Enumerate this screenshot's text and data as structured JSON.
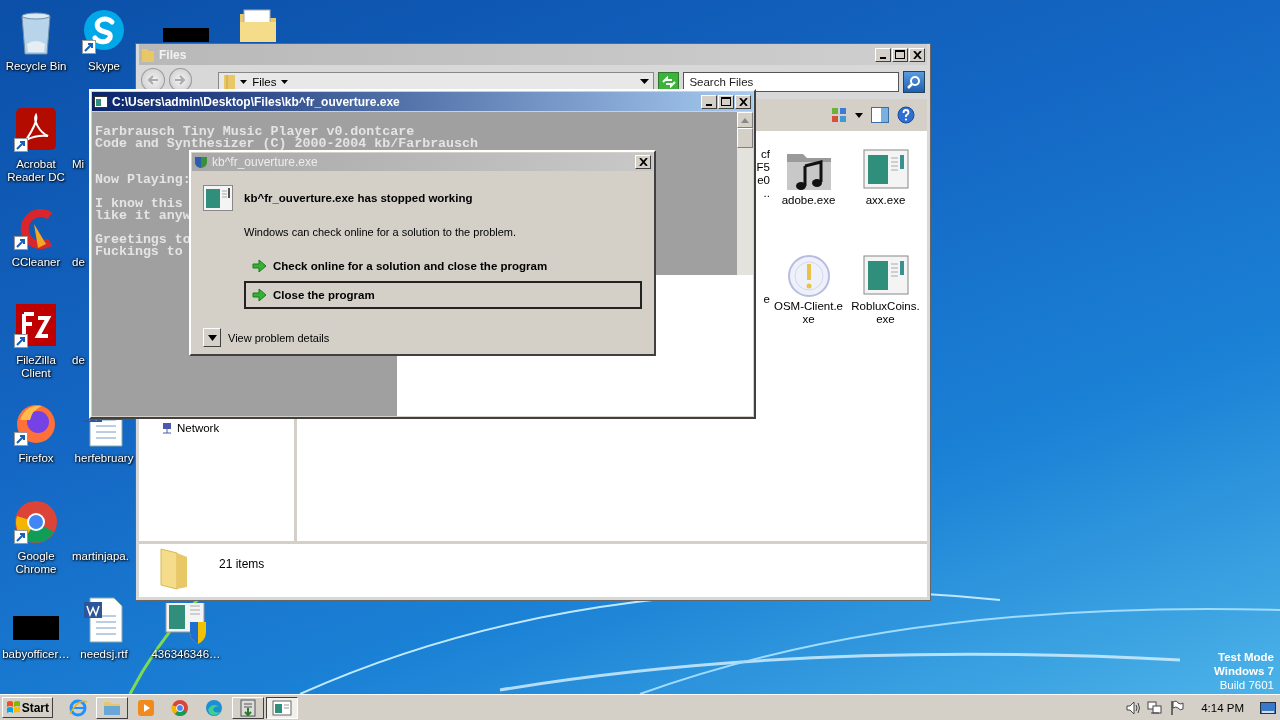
{
  "desktop_icons": [
    {
      "label": "Recycle Bin",
      "kind": "recycle"
    },
    {
      "label": "Acrobat Reader DC",
      "kind": "acrobat",
      "shortcut": true
    },
    {
      "label": "CCleaner",
      "kind": "ccleaner",
      "shortcut": true
    },
    {
      "label": "FileZilla Client",
      "kind": "filezilla",
      "shortcut": true
    },
    {
      "label": "Firefox",
      "kind": "firefox",
      "shortcut": true
    },
    {
      "label": "Google Chrome",
      "kind": "chrome",
      "shortcut": true
    },
    {
      "label": "babyofficer…",
      "kind": "redacted"
    },
    {
      "label": "Skype",
      "kind": "skype",
      "shortcut": true
    },
    {
      "label": "Mi",
      "kind": "covered"
    },
    {
      "label": "de",
      "kind": "covered"
    },
    {
      "label": "de",
      "kind": "covered"
    },
    {
      "label": "herfebruary",
      "kind": "word"
    },
    {
      "label": "martinjapa.",
      "kind": "covered"
    },
    {
      "label": "needsj.rtf",
      "kind": "word"
    },
    {
      "kind": "redacted"
    },
    {
      "label": "436346346…",
      "kind": "exe-shield"
    },
    {
      "kind": "folder"
    }
  ],
  "explorer": {
    "title": "Files",
    "breadcrumb": "Files",
    "search": {
      "placeholder": "Search Files"
    },
    "nav_items": [
      "Network"
    ],
    "files": [
      {
        "label_lines": [
          "cf",
          "F5",
          "e0",
          ".."
        ],
        "kind": "covered"
      },
      {
        "label_lines": [
          "adobe.exe"
        ],
        "kind": "music-folder"
      },
      {
        "label_lines": [
          "axx.exe"
        ],
        "kind": "app"
      },
      {
        "label_lines": [
          "e"
        ],
        "kind": "covered"
      },
      {
        "label_lines": [
          "OSM-Client.e",
          "xe"
        ],
        "kind": "info-disc"
      },
      {
        "label_lines": [
          "RobluxCoins.",
          "exe"
        ],
        "kind": "app"
      }
    ],
    "status": "21 items"
  },
  "console": {
    "title": "C:\\Users\\admin\\Desktop\\Files\\kb^fr_ouverture.exe",
    "paragraphs": [
      [
        "Farbrausch Tiny Music Player v0.dontcare",
        "Code and Synthesizer (C) 2000-2004 kb/Farbrausch"
      ],
      [
        "Now Playing:"
      ],
      [
        "I know this",
        "like it anyw"
      ],
      [
        "Greetings to",
        "Fuckings to"
      ]
    ]
  },
  "error_dialog": {
    "title": "kb^fr_ouverture.exe",
    "heading": "kb^fr_ouverture.exe has stopped working",
    "message": "Windows can check online for a solution to the problem.",
    "commands": [
      {
        "label": "Check online for a solution and close the program",
        "selected": false
      },
      {
        "label": "Close the program",
        "selected": true
      }
    ],
    "details_toggle": "View problem details"
  },
  "notice": [
    "Test Mode",
    "Windows 7",
    "Build 7601"
  ],
  "taskbar": {
    "start": "Start",
    "items": [
      {
        "kind": "ie",
        "running": false,
        "selected": false
      },
      {
        "kind": "explorer",
        "running": true,
        "selected": false
      },
      {
        "kind": "media",
        "running": false,
        "selected": false
      },
      {
        "kind": "chrome",
        "running": false,
        "selected": false
      },
      {
        "kind": "edge",
        "running": false,
        "selected": false
      },
      {
        "kind": "installer",
        "running": true,
        "selected": false
      },
      {
        "kind": "console",
        "running": true,
        "selected": true
      }
    ],
    "clock": "4:14 PM"
  }
}
